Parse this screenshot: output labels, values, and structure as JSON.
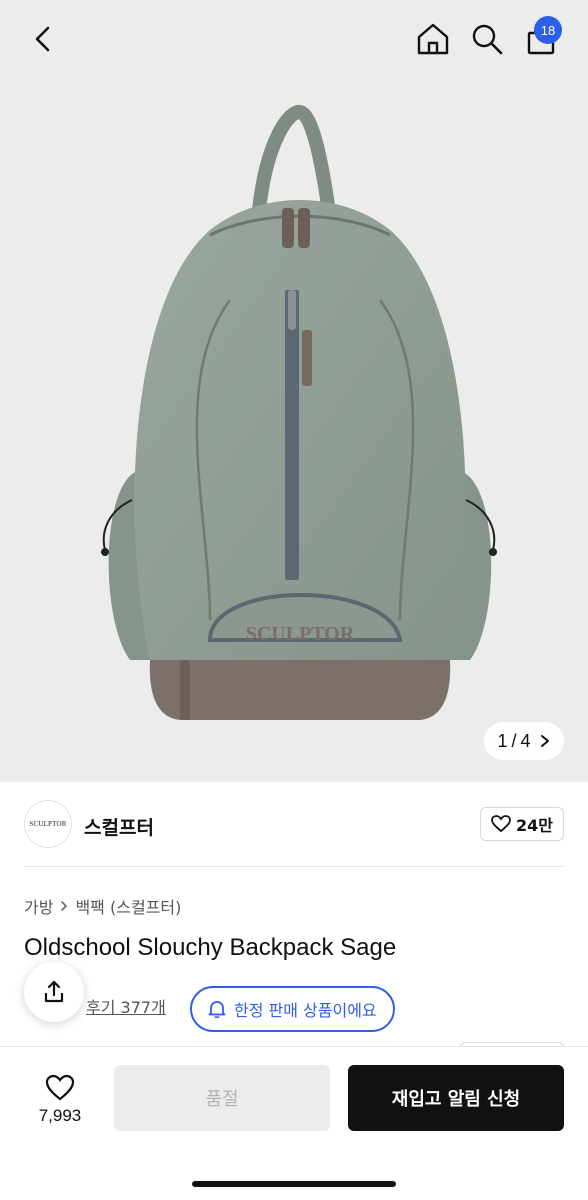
{
  "header": {
    "icons": [
      "back-icon",
      "home-icon",
      "search-icon",
      "cart-icon"
    ],
    "cart_badge": "18"
  },
  "gallery": {
    "current": "1",
    "separator": "/",
    "total": "4",
    "next_icon": "chevron-right-icon"
  },
  "brand": {
    "logo_text": "SCULPTOR",
    "name": "스컬프터",
    "likes": "24만"
  },
  "product": {
    "breadcrumb": [
      "가방",
      "백팩 (스컬프터)"
    ],
    "title": "Oldschool Slouchy Backpack Sage",
    "review_link": "후기 377개",
    "limited_badge": "한정 판매 상품이에요"
  },
  "bottom_bar": {
    "wish_count": "7,993",
    "soldout_label": "품절",
    "restock_label": "재입고 알림 신청"
  },
  "colors": {
    "accent": "#2f5fe8",
    "bag_body": "#8f9c93",
    "bag_base": "#7a6e68",
    "hero_bg": "#ececec"
  }
}
